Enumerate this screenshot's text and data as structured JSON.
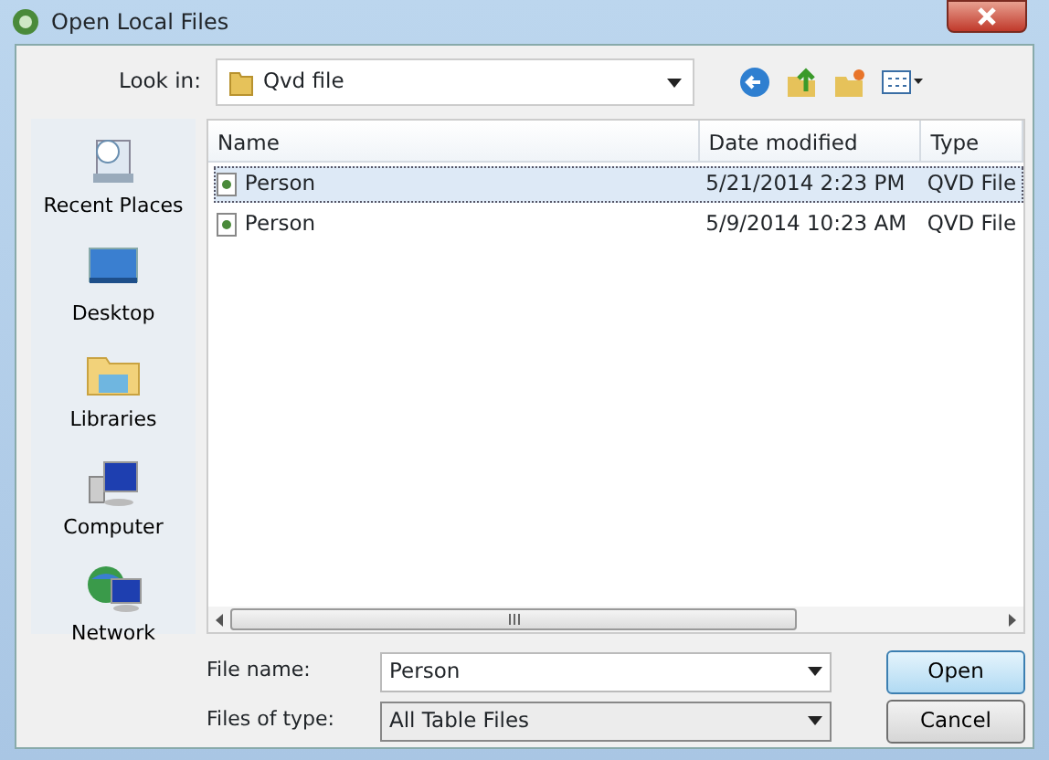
{
  "window": {
    "title": "Open Local Files"
  },
  "look_in": {
    "label": "Look in:",
    "value": "Qvd file"
  },
  "places": [
    {
      "label": "Recent Places",
      "kind": "recent"
    },
    {
      "label": "Desktop",
      "kind": "desktop"
    },
    {
      "label": "Libraries",
      "kind": "libraries"
    },
    {
      "label": "Computer",
      "kind": "computer"
    },
    {
      "label": "Network",
      "kind": "network"
    }
  ],
  "table": {
    "columns": [
      "Name",
      "Date modified",
      "Type"
    ],
    "rows": [
      {
        "name": "Person",
        "date": "5/21/2014 2:23 PM",
        "type": "QVD File",
        "selected": true
      },
      {
        "name": "Person",
        "date": "5/9/2014 10:23 AM",
        "type": "QVD File",
        "selected": false
      }
    ]
  },
  "file_name": {
    "label": "File name:",
    "value": "Person"
  },
  "file_type": {
    "label": "Files of type:",
    "value": "All Table Files"
  },
  "buttons": [
    {
      "label": "Open",
      "kind": "default"
    },
    {
      "label": "Cancel",
      "kind": "normal"
    }
  ]
}
